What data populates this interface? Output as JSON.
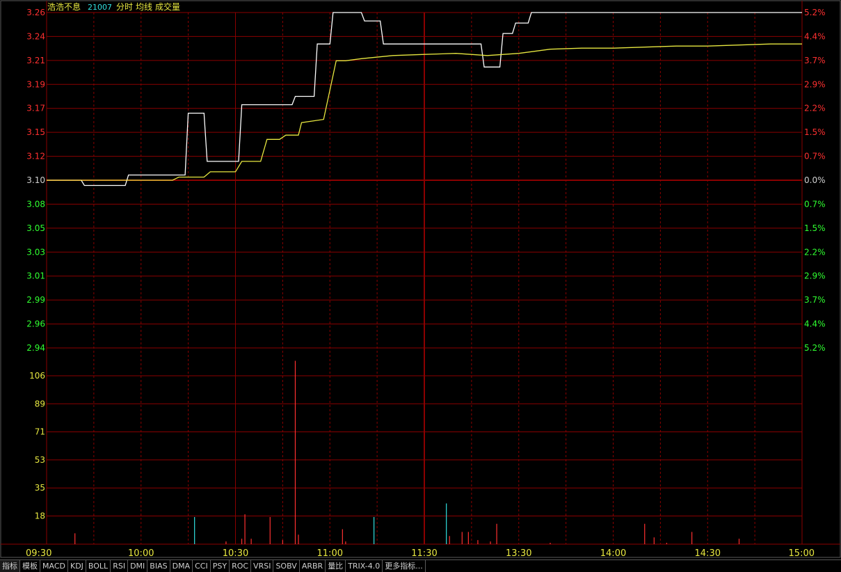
{
  "header": {
    "name": "浩浩不息",
    "code": "21007",
    "labels": [
      "分时",
      "均线",
      "成交量"
    ]
  },
  "colors": {
    "background": "#000000",
    "grid": "#8b0000",
    "up": "#ff3030",
    "down": "#30ff30",
    "neutral": "#d0d0d0",
    "price_line": "#ffffff",
    "avg_line": "#e8e840",
    "volume_up": "#ff3030",
    "volume_down": "#30e0e0",
    "volume_axis": "#e8e840",
    "time_axis": "#e8e840"
  },
  "chart_data": [
    {
      "type": "line",
      "panel": "price",
      "x_ticks": [
        "09:30",
        "10:00",
        "10:30",
        "11:00",
        "11:30",
        "13:30",
        "14:00",
        "14:30",
        "15:00"
      ],
      "y_ticks_left": [
        "3.26",
        "3.24",
        "3.21",
        "3.19",
        "3.17",
        "3.15",
        "3.12",
        "3.10",
        "3.08",
        "3.05",
        "3.03",
        "3.01",
        "2.99",
        "2.96",
        "2.94"
      ],
      "y_ticks_right": [
        "5.2%",
        "4.4%",
        "3.7%",
        "2.9%",
        "2.2%",
        "1.5%",
        "0.7%",
        "0.0%",
        "0.7%",
        "1.5%",
        "2.2%",
        "2.9%",
        "3.7%",
        "4.4%",
        "5.2%"
      ],
      "base_price": 3.1,
      "ylim": [
        2.94,
        3.26
      ],
      "series": [
        {
          "name": "分时",
          "x": [
            0,
            11,
            12,
            25,
            26,
            44,
            45,
            50,
            51,
            56,
            57,
            61,
            62,
            75,
            76,
            78,
            79,
            85,
            86,
            90,
            91,
            100,
            101,
            106,
            107,
            115,
            116,
            138,
            139,
            144,
            145,
            148,
            149,
            153,
            154,
            240
          ],
          "values": [
            3.1,
            3.1,
            3.095,
            3.095,
            3.105,
            3.105,
            3.164,
            3.164,
            3.118,
            3.118,
            3.118,
            3.118,
            3.172,
            3.172,
            3.172,
            3.172,
            3.18,
            3.18,
            3.23,
            3.23,
            3.26,
            3.26,
            3.252,
            3.252,
            3.23,
            3.23,
            3.23,
            3.23,
            3.208,
            3.208,
            3.24,
            3.24,
            3.25,
            3.25,
            3.26,
            3.26
          ]
        },
        {
          "name": "均线",
          "x": [
            0,
            40,
            42,
            50,
            52,
            60,
            62,
            68,
            70,
            74,
            76,
            80,
            81,
            88,
            92,
            95,
            100,
            110,
            120,
            130,
            140,
            150,
            160,
            170,
            180,
            190,
            200,
            210,
            220,
            230,
            240
          ],
          "values": [
            3.1,
            3.1,
            3.103,
            3.103,
            3.108,
            3.108,
            3.118,
            3.118,
            3.139,
            3.139,
            3.143,
            3.143,
            3.155,
            3.158,
            3.214,
            3.214,
            3.216,
            3.219,
            3.22,
            3.221,
            3.219,
            3.221,
            3.225,
            3.226,
            3.226,
            3.227,
            3.228,
            3.228,
            3.229,
            3.23,
            3.23
          ]
        }
      ]
    },
    {
      "type": "bar",
      "panel": "volume",
      "y_ticks": [
        "106",
        "89",
        "71",
        "53",
        "35",
        "18"
      ],
      "ylim": [
        0,
        124
      ],
      "bars": [
        {
          "x": 9,
          "value": 8,
          "dir": "up"
        },
        {
          "x": 47,
          "value": 20,
          "dir": "down"
        },
        {
          "x": 57,
          "value": 2,
          "dir": "up"
        },
        {
          "x": 62,
          "value": 4,
          "dir": "up"
        },
        {
          "x": 63,
          "value": 22,
          "dir": "up"
        },
        {
          "x": 65,
          "value": 4,
          "dir": "up"
        },
        {
          "x": 71,
          "value": 20,
          "dir": "up"
        },
        {
          "x": 75,
          "value": 3,
          "dir": "up"
        },
        {
          "x": 79,
          "value": 135,
          "dir": "up"
        },
        {
          "x": 80,
          "value": 7,
          "dir": "up"
        },
        {
          "x": 94,
          "value": 11,
          "dir": "up"
        },
        {
          "x": 95,
          "value": 2,
          "dir": "up"
        },
        {
          "x": 104,
          "value": 20,
          "dir": "down"
        },
        {
          "x": 127,
          "value": 30,
          "dir": "down"
        },
        {
          "x": 128,
          "value": 6,
          "dir": "up"
        },
        {
          "x": 132,
          "value": 9,
          "dir": "up"
        },
        {
          "x": 134,
          "value": 9,
          "dir": "up"
        },
        {
          "x": 137,
          "value": 3,
          "dir": "up"
        },
        {
          "x": 141,
          "value": 2,
          "dir": "up"
        },
        {
          "x": 143,
          "value": 15,
          "dir": "up"
        },
        {
          "x": 160,
          "value": 1,
          "dir": "up"
        },
        {
          "x": 190,
          "value": 15,
          "dir": "up"
        },
        {
          "x": 193,
          "value": 5,
          "dir": "up"
        },
        {
          "x": 197,
          "value": 1,
          "dir": "up"
        },
        {
          "x": 205,
          "value": 9,
          "dir": "up"
        },
        {
          "x": 220,
          "value": 4,
          "dir": "up"
        }
      ]
    }
  ],
  "tabs": [
    "指标",
    "模板",
    "MACD",
    "KDJ",
    "BOLL",
    "RSI",
    "DMI",
    "BIAS",
    "DMA",
    "CCI",
    "PSY",
    "ROC",
    "VRSI",
    "SOBV",
    "ARBR",
    "量比",
    "TRIX-4.0",
    "更多指标..."
  ]
}
